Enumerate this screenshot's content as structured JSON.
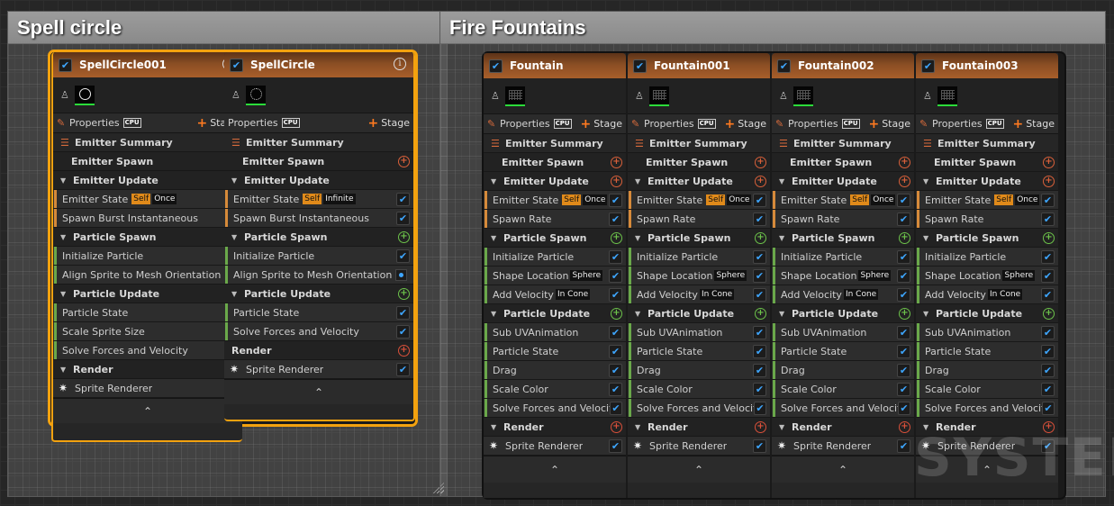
{
  "comments": [
    {
      "title": "Spell circle"
    },
    {
      "title": "Fire Fountains"
    }
  ],
  "common": {
    "properties_label": "Properties",
    "cpu_label": "CPU",
    "stage_label": "Stage",
    "emitter_summary": "Emitter Summary",
    "emitter_spawn": "Emitter Spawn",
    "emitter_update": "Emitter Update",
    "particle_spawn": "Particle Spawn",
    "particle_update": "Particle Update",
    "render": "Render",
    "emitter_state": "Emitter State",
    "self_badge": "Self",
    "sprite_renderer": "Sprite Renderer",
    "info_glyph": "i",
    "collapse_glyph": "⌃"
  },
  "spell_emitters": [
    {
      "name": "SpellCircle001",
      "lifecycle": "Once",
      "emitter_update_modules": [
        "Spawn Burst Instantaneous"
      ],
      "particle_spawn_modules": [
        "Initialize Particle",
        "Align Sprite to Mesh Orientation"
      ],
      "particle_update_modules": [
        "Particle State",
        "Scale Sprite Size",
        "Solve Forces and Velocity"
      ]
    },
    {
      "name": "SpellCircle",
      "lifecycle": "Infinite",
      "emitter_update_modules": [
        "Spawn Burst Instantaneous"
      ],
      "particle_spawn_modules": [
        "Initialize Particle",
        "Align Sprite to Mesh Orientation"
      ],
      "particle_update_modules": [
        "Particle State",
        "Solve Forces and Velocity"
      ]
    }
  ],
  "fountain_emitters": [
    {
      "name": "Fountain"
    },
    {
      "name": "Fountain001"
    },
    {
      "name": "Fountain002"
    },
    {
      "name": "Fountain003"
    }
  ],
  "fountain_common": {
    "lifecycle": "Once",
    "spawn_rate": "Spawn Rate",
    "initialize_particle": "Initialize Particle",
    "shape_location": "Shape Location",
    "shape_badge": "Sphere",
    "add_velocity": "Add Velocity",
    "velocity_badge": "In Cone",
    "particle_update_modules": [
      "Sub UVAnimation",
      "Particle State",
      "Drag",
      "Scale Color",
      "Solve Forces and Velocity"
    ]
  },
  "watermark": "SYSTEM",
  "colors": {
    "selection_outline": "#f3a20f",
    "emitter_header": "#a85e2a",
    "checkbox_tick": "#3ea6ff",
    "self_badge": "#e08a1a"
  }
}
